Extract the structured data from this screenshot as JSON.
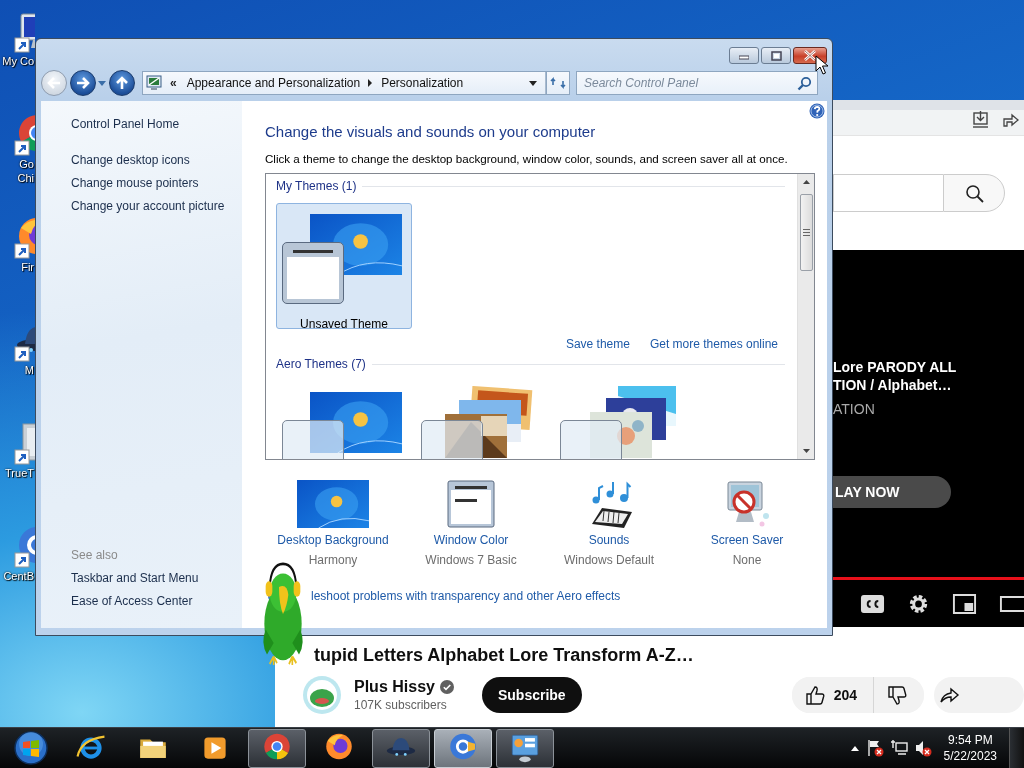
{
  "desktop_icons": [
    {
      "kind": "computer",
      "lines": [
        "My Co"
      ]
    },
    {
      "kind": "chrome",
      "lines": [
        "Go",
        "Chi"
      ]
    },
    {
      "kind": "firefox",
      "lines": [
        "Fir"
      ]
    },
    {
      "kind": "ufo",
      "lines": [
        "M"
      ]
    },
    {
      "kind": "document",
      "lines": [
        "TrueT"
      ]
    },
    {
      "kind": "centbrowser",
      "lines": [
        "CentB"
      ]
    }
  ],
  "browser": {
    "video": {
      "title_lines": [
        "Lore PARODY ALL",
        "TION / Alphabet…"
      ],
      "subtitle": "ATION",
      "play_button": "LAY NOW",
      "progress": {
        "level": 1
      }
    },
    "title": "tupid Letters Alphabet Lore Transform A-Z…",
    "channel": {
      "name": "Plus Hissy",
      "verified": true,
      "subscribers": "107K subscribers"
    },
    "subscribe_button": "Subscribe",
    "likes": "204"
  },
  "control_panel": {
    "nav": {
      "back": {
        "disabled": true
      },
      "forward": {
        "disabled": false
      }
    },
    "address": {
      "prefix": "«",
      "crumbs": [
        "Appearance and Personalization",
        "Personalization"
      ]
    },
    "search": {
      "placeholder": "Search Control Panel"
    },
    "left_pane": {
      "home": "Control Panel Home",
      "tasks": [
        "Change desktop icons",
        "Change mouse pointers",
        "Change your account picture"
      ],
      "see_also": {
        "heading": "See also",
        "links": [
          "Taskbar and Start Menu",
          "Ease of Access Center"
        ]
      }
    },
    "main": {
      "heading": "Change the visuals and sounds on your computer",
      "subtitle": "Click a theme to change the desktop background, window color, sounds, and screen saver all at once.",
      "theme_groups": [
        {
          "title": "My Themes (1)",
          "themes": [
            {
              "kind": "custom",
              "label": "Unsaved Theme",
              "selected": true
            }
          ],
          "links": [
            "Save theme",
            "Get more themes online"
          ]
        },
        {
          "title": "Aero Themes (7)",
          "themes": [
            {
              "kind": "windows",
              "selected": false
            },
            {
              "kind": "landscapes",
              "selected": false
            },
            {
              "kind": "nature",
              "selected": false
            }
          ]
        }
      ],
      "settings": [
        {
          "kind": "background",
          "label": "Desktop Background",
          "value": "Harmony"
        },
        {
          "kind": "window_color",
          "label": "Window Color",
          "value": "Windows 7 Basic"
        },
        {
          "kind": "sounds",
          "label": "Sounds",
          "value": "Windows Default"
        },
        {
          "kind": "screen_saver",
          "label": "Screen Saver",
          "value": "None"
        }
      ],
      "troubleshoot_link": "leshoot problems with transparency and other Aero effects"
    }
  },
  "taskbar": {
    "apps": [
      {
        "kind": "ie",
        "open": false,
        "selected": false
      },
      {
        "kind": "explorer",
        "open": false,
        "selected": false
      },
      {
        "kind": "media",
        "open": false,
        "selected": false
      },
      {
        "kind": "chrome",
        "open": true,
        "selected": false
      },
      {
        "kind": "firefox",
        "open": false,
        "selected": false
      },
      {
        "kind": "ufo",
        "open": true,
        "selected": false
      },
      {
        "kind": "centbrowser",
        "open": true,
        "selected": true
      },
      {
        "kind": "controlpanel",
        "open": true,
        "selected": false
      }
    ],
    "clock": {
      "time": "9:54 PM",
      "date": "5/22/2023"
    }
  }
}
